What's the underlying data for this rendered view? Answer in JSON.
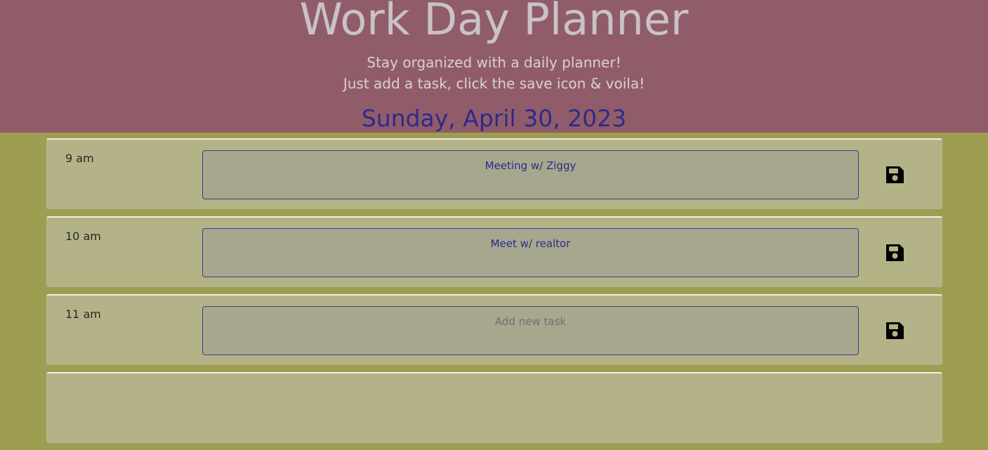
{
  "header": {
    "title": "Work Day Planner",
    "lead_line1": "Stay organized with a daily planner!",
    "lead_line2": "Just add a task, click the save icon & voila!",
    "current_day": "Sunday, April 30, 2023"
  },
  "colors": {
    "header_bg": "#915c6a",
    "page_bg": "#9e9e52",
    "row_bg": "#b4b388",
    "date_color": "#2d2a8c"
  },
  "rows": [
    {
      "hour": "9 am",
      "task": "Meeting w/ Ziggy",
      "placeholder": "Add new task",
      "icon": "save-floppy-icon"
    },
    {
      "hour": "10 am",
      "task": "Meet w/ realtor",
      "placeholder": "Add new task",
      "icon": "save-floppy-icon"
    },
    {
      "hour": "11 am",
      "task": "",
      "placeholder": "Add new task",
      "icon": "save-floppy-icon"
    }
  ]
}
